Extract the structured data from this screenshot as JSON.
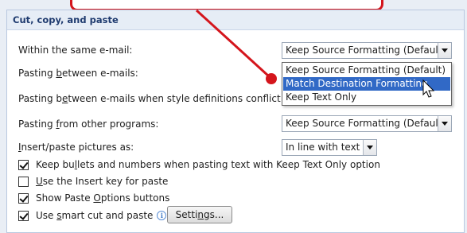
{
  "section_title": "Cut, copy, and paste",
  "rows": [
    {
      "label_pre": "Within the same e-mail:",
      "label_u": "",
      "label_post": "",
      "value": "Keep Source Formatting (Default)"
    },
    {
      "label_pre": "Pasting ",
      "label_u": "b",
      "label_post": "etween e-mails:",
      "value": ""
    },
    {
      "label_pre": "Pasting b",
      "label_u": "e",
      "label_post": "tween e-mails when style definitions conflict:",
      "value": ""
    },
    {
      "label_pre": "Pasting ",
      "label_u": "f",
      "label_post": "rom other programs:",
      "value": "Keep Source Formatting (Default)"
    },
    {
      "label_pre": "",
      "label_u": "I",
      "label_post": "nsert/paste pictures as:",
      "value": "In line with text"
    }
  ],
  "dropdown_menu": {
    "options": [
      "Keep Source Formatting (Default)",
      "Match Destination Formatting",
      "Keep Text Only"
    ],
    "selected": "Match Destination Formatting"
  },
  "checkboxes": [
    {
      "pre": "Keep bu",
      "u": "l",
      "post": "lets and numbers when pasting text with Keep Text Only option",
      "checked": true
    },
    {
      "pre": "",
      "u": "U",
      "post": "se the Insert key for paste",
      "checked": false
    },
    {
      "pre": "Show Paste ",
      "u": "O",
      "post": "ptions buttons",
      "checked": true
    },
    {
      "pre": "Use ",
      "u": "s",
      "post": "mart cut and paste",
      "checked": true
    }
  ],
  "settings_button": {
    "pre": "Setti",
    "u": "n",
    "post": "gs..."
  },
  "colors": {
    "callout_red": "#d4151c",
    "selection_blue": "#3169c6",
    "header_bg": "#e6edf6"
  }
}
